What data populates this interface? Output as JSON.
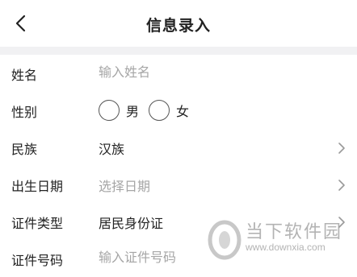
{
  "nav": {
    "title": "信息录入"
  },
  "form": {
    "name": {
      "label": "姓名",
      "placeholder": "输入姓名"
    },
    "gender": {
      "label": "性别",
      "options": [
        "男",
        "女"
      ]
    },
    "ethnicity": {
      "label": "民族",
      "value": "汉族"
    },
    "birthdate": {
      "label": "出生日期",
      "placeholder": "选择日期"
    },
    "id_type": {
      "label": "证件类型",
      "value": "居民身份证"
    },
    "id_number": {
      "label": "证件号码",
      "placeholder": "输入证件号码"
    }
  },
  "watermark": {
    "brand": "当下软件园",
    "url": "www.downxia.com"
  },
  "colors": {
    "text": "#222222",
    "placeholder": "#a6a6a6",
    "divider": "#f1f1f3"
  }
}
